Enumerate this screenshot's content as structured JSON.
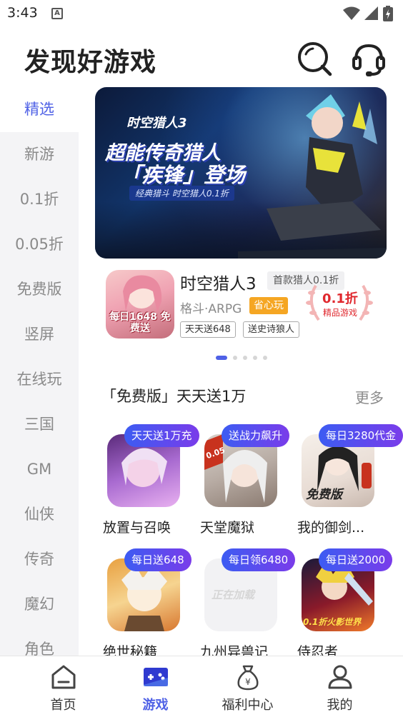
{
  "status": {
    "time": "3:43",
    "notif_letter": "A"
  },
  "header": {
    "title": "发现好游戏"
  },
  "sidebar": {
    "items": [
      {
        "label": "精选",
        "active": true
      },
      {
        "label": "新游"
      },
      {
        "label": "0.1折"
      },
      {
        "label": "0.05折"
      },
      {
        "label": "免费版"
      },
      {
        "label": "竖屏"
      },
      {
        "label": "在线玩"
      },
      {
        "label": "三国"
      },
      {
        "label": "GM"
      },
      {
        "label": "仙侠"
      },
      {
        "label": "传奇"
      },
      {
        "label": "魔幻"
      },
      {
        "label": "角色"
      }
    ]
  },
  "banner": {
    "logo": "时空猎人3",
    "line1": "超能传奇猎人",
    "line2": "「疾锋」登场",
    "line3": "经典猎斗 时空猎人0.1折"
  },
  "featured": {
    "icon_text": "每日1648 免费送",
    "name": "时空猎人3",
    "tag": "首款猎人0.1折",
    "genre": "格斗·ARPG",
    "badge": "省心玩",
    "chips": [
      "天天送648",
      "送史诗狼人"
    ],
    "discount": "0.1折",
    "discount_note": "精品游戏"
  },
  "carousel": {
    "count": 5,
    "active_index": 0
  },
  "section": {
    "title": "「免费版」天天送1万",
    "more": "更多",
    "games": [
      {
        "name": "放置与召唤",
        "pill": "天天送1万充"
      },
      {
        "name": "天堂魔狱",
        "pill": "送战力飙升",
        "icon_text": "0.05"
      },
      {
        "name": "我的御剑...",
        "pill": "每日3280代金",
        "icon_text": "免费版"
      },
      {
        "name": "绝世秘籍",
        "pill": "每日送648"
      },
      {
        "name": "九州异兽记",
        "pill": "每日领6480",
        "icon_text": "正在加载"
      },
      {
        "name": "侍忍者",
        "pill": "每日送2000",
        "icon_text": "0.1折火影世界"
      }
    ]
  },
  "bottom_nav": {
    "items": [
      {
        "label": "首页"
      },
      {
        "label": "游戏",
        "active": true
      },
      {
        "label": "福利中心"
      },
      {
        "label": "我的"
      }
    ]
  },
  "colors": {
    "accent": "#4f61e6",
    "badge_orange": "#f5a623",
    "discount_red": "#e0282e"
  }
}
